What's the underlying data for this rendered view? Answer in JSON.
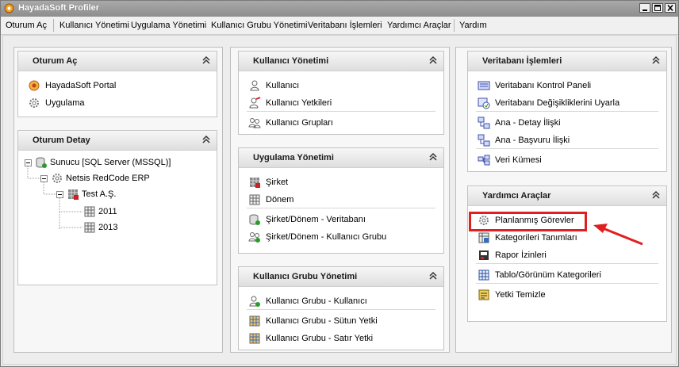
{
  "window": {
    "title": "HayadaSoft Profiler",
    "buttons": [
      "minimize",
      "maximize",
      "close"
    ]
  },
  "menubar": {
    "items": [
      {
        "label": "Oturum Aç"
      },
      {
        "label": "Kullanıcı Yönetimi"
      },
      {
        "label": "Uygulama Yönetimi"
      },
      {
        "label": "Kullanıcı Grubu Yönetimi"
      },
      {
        "label": "Veritabanı İşlemleri"
      },
      {
        "label": "Yardımcı Araçlar"
      },
      {
        "label": "Yardım"
      }
    ]
  },
  "panels": {
    "oturum_ac": {
      "title": "Oturum Aç",
      "items": [
        {
          "label": "HayadaSoft Portal",
          "icon": "portal-icon"
        },
        {
          "label": "Uygulama",
          "icon": "gear-icon"
        }
      ]
    },
    "oturum_detay": {
      "title": "Oturum Detay",
      "tree": [
        {
          "label": "Sunucu [SQL Server (MSSQL)]",
          "icon": "database-icon"
        },
        {
          "label": "Netsis RedCode ERP",
          "icon": "gear-icon"
        },
        {
          "label": "Test A.Ş.",
          "icon": "company-icon"
        },
        {
          "label": "2011",
          "icon": "grid-icon"
        },
        {
          "label": "2013",
          "icon": "grid-icon"
        }
      ]
    },
    "kullanici_yonetimi": {
      "title": "Kullanıcı Yönetimi",
      "items": [
        {
          "label": "Kullanıcı",
          "icon": "user-icon"
        },
        {
          "label": "Kullanıcı Yetkileri",
          "icon": "user-key-icon"
        },
        {
          "label": "Kullanıcı Grupları",
          "icon": "users-icon"
        }
      ]
    },
    "uygulama_yonetimi": {
      "title": "Uygulama Yönetimi",
      "items": [
        {
          "label": "Şirket",
          "icon": "company-icon"
        },
        {
          "label": "Dönem",
          "icon": "grid-icon"
        },
        {
          "label": "Şirket/Dönem - Veritabanı",
          "icon": "database-add-icon"
        },
        {
          "label": "Şirket/Dönem - Kullanıcı Grubu",
          "icon": "users-add-icon"
        }
      ]
    },
    "kullanici_grubu_yonetimi": {
      "title": "Kullanıcı Grubu Yönetimi",
      "items": [
        {
          "label": "Kullanıcı Grubu - Kullanıcı",
          "icon": "user-add-icon"
        },
        {
          "label": "Kullanıcı Grubu - Sütun Yetki",
          "icon": "table-icon"
        },
        {
          "label": "Kullanıcı Grubu - Satır Yetki",
          "icon": "table-icon"
        }
      ]
    },
    "veritabani_islemleri": {
      "title": "Veritabanı İşlemleri",
      "items": [
        {
          "label": "Veritabanı Kontrol Paneli",
          "icon": "control-panel-icon"
        },
        {
          "label": "Veritabanı Değişikliklerini Uyarla",
          "icon": "db-sync-icon"
        },
        {
          "label": "Ana - Detay İlişki",
          "icon": "relation-icon"
        },
        {
          "label": "Ana - Başvuru İlişki",
          "icon": "relation-icon"
        },
        {
          "label": "Veri Kümesi",
          "icon": "dataset-icon"
        }
      ]
    },
    "yardimci_araclar": {
      "title": "Yardımcı Araçlar",
      "items": [
        {
          "label": "Planlanmış Görevler",
          "icon": "gear-icon"
        },
        {
          "label": "Kategorileri Tanımları",
          "icon": "category-icon"
        },
        {
          "label": "Rapor İzinleri",
          "icon": "report-icon"
        },
        {
          "label": "Tablo/Görünüm Kategorileri",
          "icon": "grid-icon"
        },
        {
          "label": "Yetki Temizle",
          "icon": "clean-icon"
        }
      ]
    }
  },
  "colors": {
    "highlight": "#e02020",
    "titlebar": "#9a9a9a"
  }
}
